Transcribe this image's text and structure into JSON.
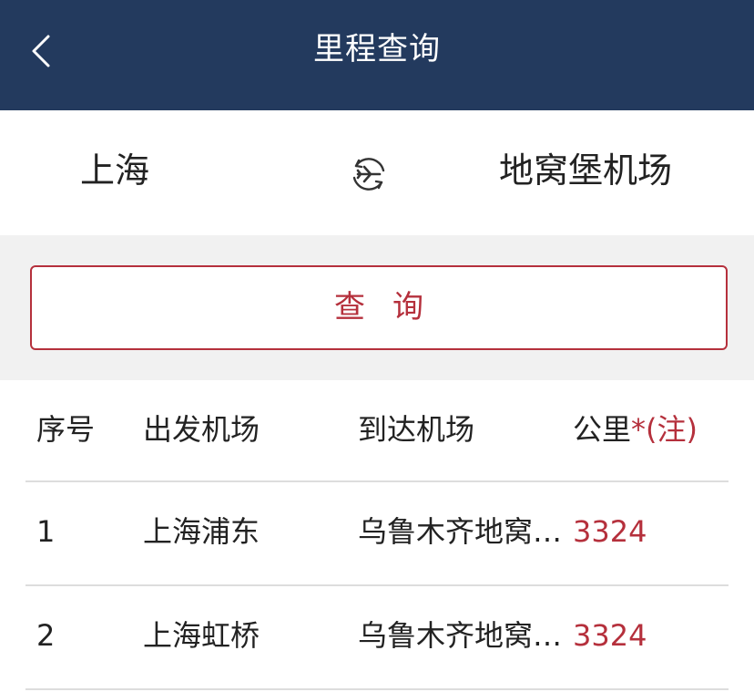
{
  "header": {
    "title": "里程查询"
  },
  "route": {
    "from": "上海",
    "to": "地窝堡机场"
  },
  "search": {
    "label": "查询"
  },
  "table": {
    "columns": {
      "no": "序号",
      "departure": "出发机场",
      "arrival": "到达机场",
      "km": "公里",
      "note": "*(注)"
    },
    "rows": [
      {
        "no": "1",
        "departure": "上海浦东",
        "arrival": "乌鲁木齐地窝堡机场",
        "km": "3324"
      },
      {
        "no": "2",
        "departure": "上海虹桥",
        "arrival": "乌鲁木齐地窝堡机场",
        "km": "3324"
      }
    ]
  },
  "colors": {
    "header_bg": "#233a5e",
    "accent": "#b5303c",
    "band_bg": "#f1f1f1"
  },
  "icons": [
    "chevron-left-icon",
    "plane-swap-icon"
  ]
}
